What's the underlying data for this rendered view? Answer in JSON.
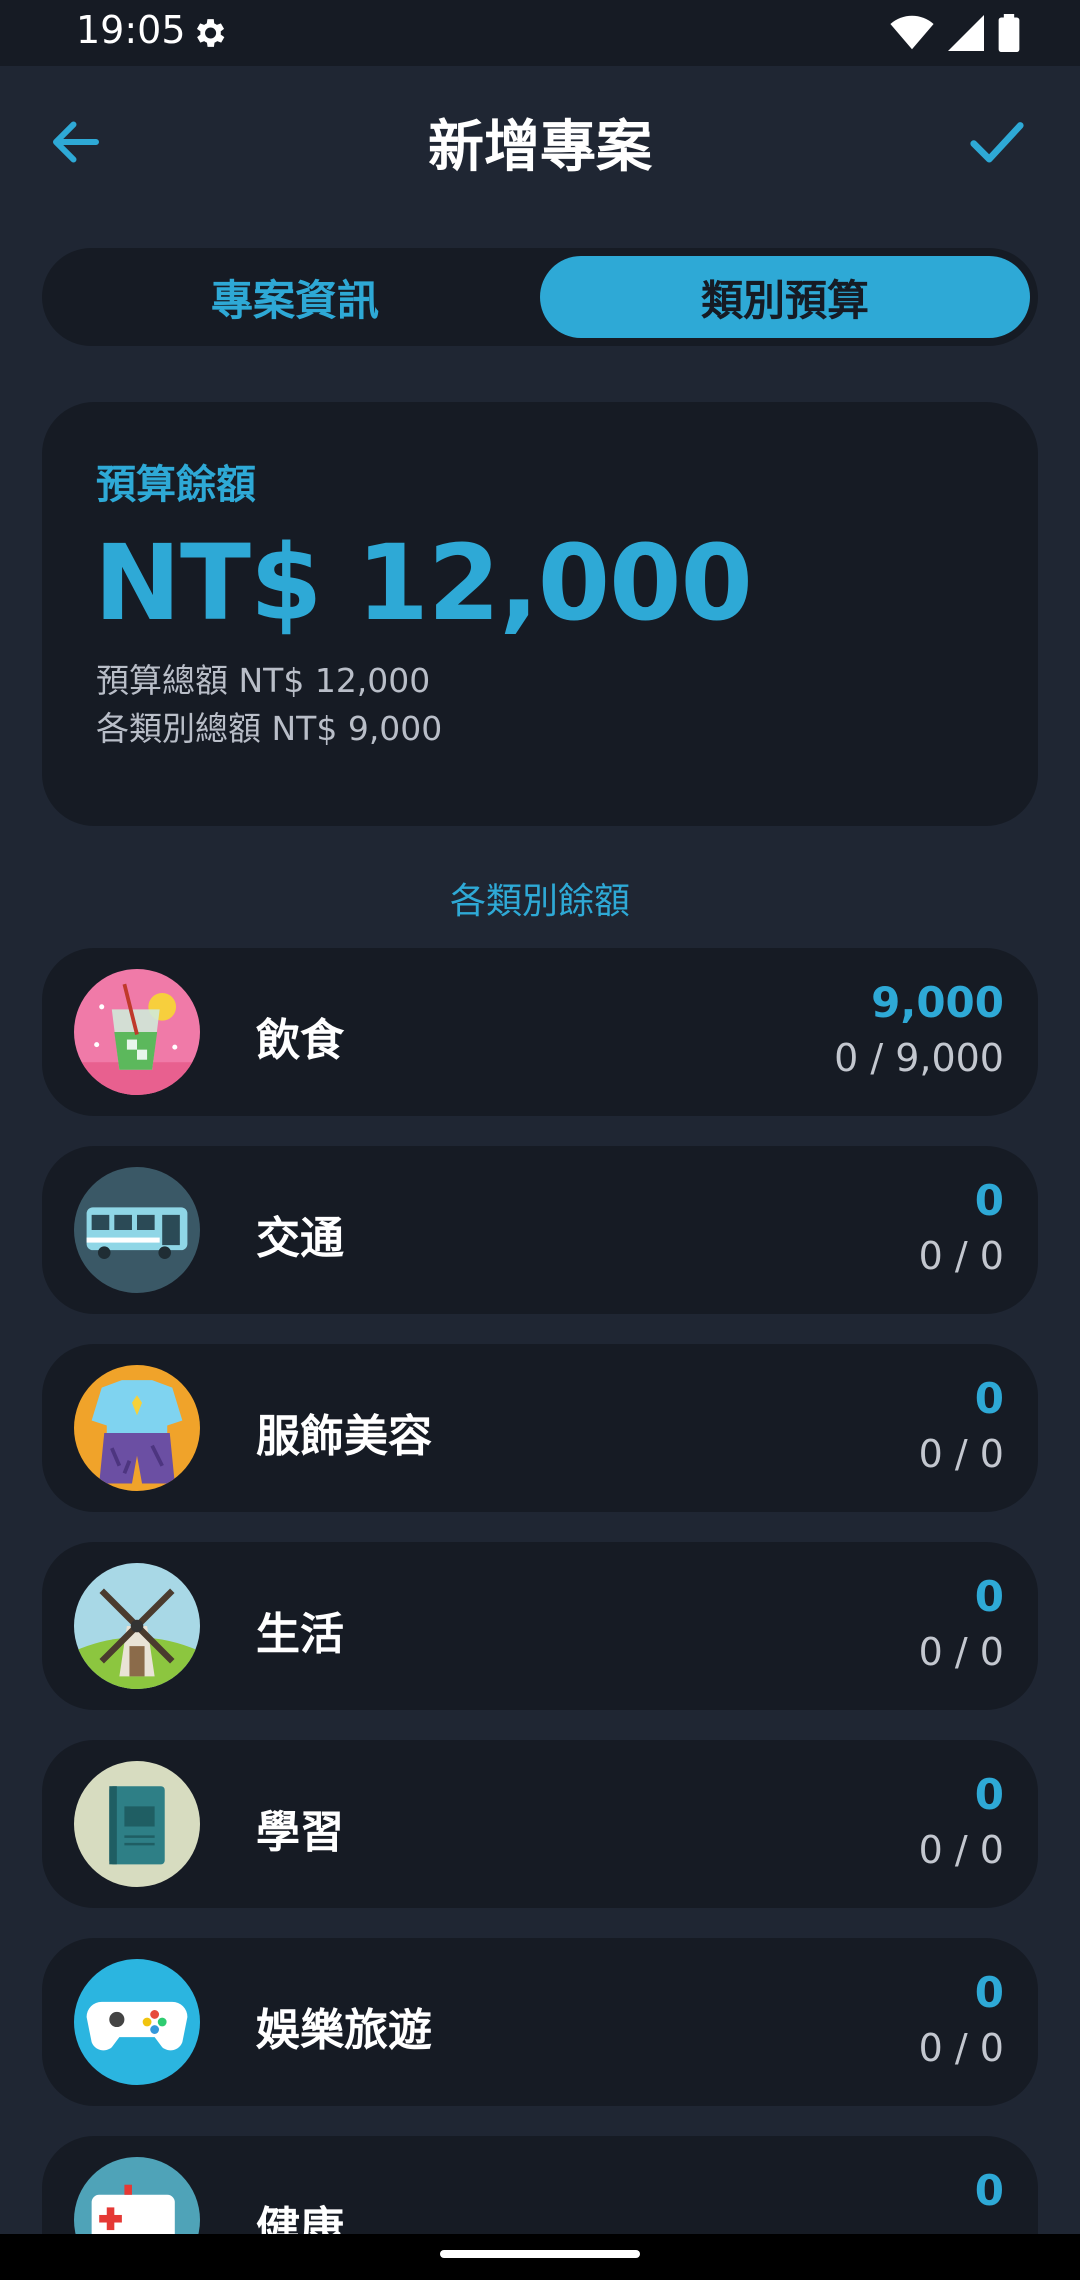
{
  "status_bar": {
    "time": "19:05"
  },
  "header": {
    "title": "新增專案"
  },
  "tabs": [
    {
      "label": "專案資訊",
      "selected": false
    },
    {
      "label": "類別預算",
      "selected": true
    }
  ],
  "summary": {
    "label": "預算餘額",
    "amount": "NT$ 12,000",
    "total_budget": "預算總額 NT$ 12,000",
    "category_total": "各類別總額 NT$ 9,000"
  },
  "section_title": "各類別餘額",
  "categories": [
    {
      "name": "飲食",
      "remaining": "9,000",
      "ratio": "0 / 9,000",
      "icon": "drink-icon"
    },
    {
      "name": "交通",
      "remaining": "0",
      "ratio": "0 / 0",
      "icon": "bus-icon"
    },
    {
      "name": "服飾美容",
      "remaining": "0",
      "ratio": "0 / 0",
      "icon": "clothing-icon"
    },
    {
      "name": "生活",
      "remaining": "0",
      "ratio": "0 / 0",
      "icon": "windmill-icon"
    },
    {
      "name": "學習",
      "remaining": "0",
      "ratio": "0 / 0",
      "icon": "book-icon"
    },
    {
      "name": "娛樂旅遊",
      "remaining": "0",
      "ratio": "0 / 0",
      "icon": "gamepad-icon"
    },
    {
      "name": "健康",
      "remaining": "0",
      "ratio": "",
      "icon": "ambulance-icon"
    }
  ],
  "colors": {
    "accent": "#2ea9d6",
    "background": "#1f2633",
    "card": "#161b24"
  }
}
